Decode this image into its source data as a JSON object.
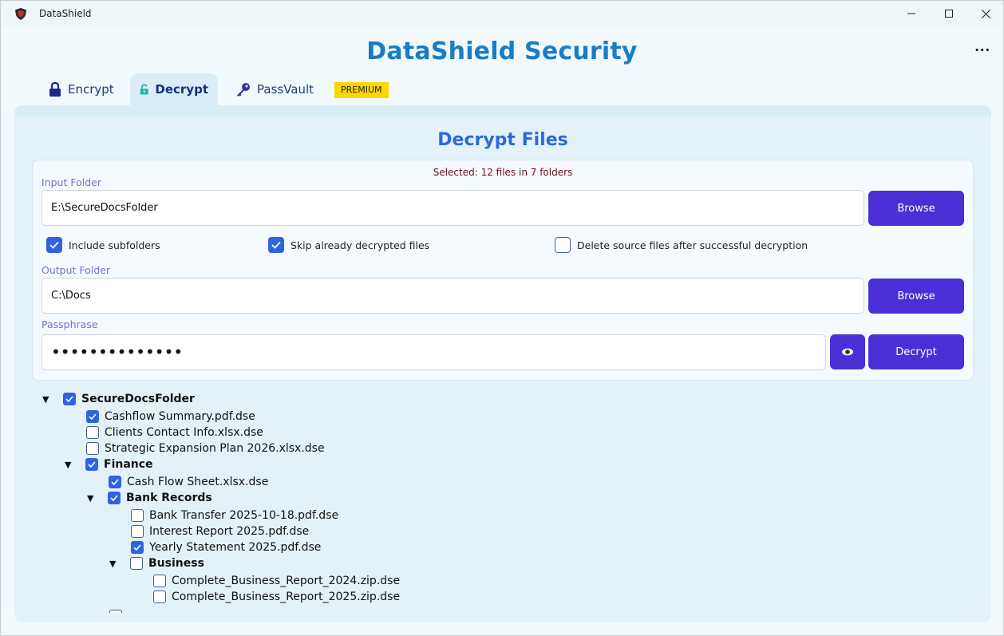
{
  "window": {
    "title": "DataShield",
    "controls": [
      "minimize-icon",
      "maximize-icon",
      "close-icon"
    ]
  },
  "app": {
    "title": "DataShield Security",
    "more_menu": "..."
  },
  "tabs": [
    {
      "label": "Encrypt",
      "icon": "lock-icon",
      "active": false
    },
    {
      "label": "Decrypt",
      "icon": "unlock-icon",
      "active": true
    },
    {
      "label": "PassVault",
      "icon": "key-icon",
      "active": false
    }
  ],
  "premium_badge": "PREMIUM",
  "panel": {
    "title": "Decrypt Files",
    "selected_info": "Selected: 12 files in 7 folders"
  },
  "form": {
    "input_folder": {
      "label": "Input Folder",
      "value": "E:\\SecureDocsFolder",
      "browse": "Browse"
    },
    "options": [
      {
        "label": "Include subfolders",
        "checked": true
      },
      {
        "label": "Skip already decrypted files",
        "checked": true
      },
      {
        "label": "Delete source files after successful decryption",
        "checked": false
      }
    ],
    "output_folder": {
      "label": "Output Folder",
      "value": "C:\\Docs",
      "browse": "Browse"
    },
    "passphrase": {
      "label": "Passphrase",
      "value": "••••••••••••••",
      "toggle_icon": "eye-icon",
      "action": "Decrypt"
    }
  },
  "tree": [
    {
      "label": "SecureDocsFolder",
      "folder": true,
      "checked": true,
      "level": 0
    },
    {
      "label": "Cashflow Summary.pdf.dse",
      "folder": false,
      "checked": true,
      "level": 1
    },
    {
      "label": "Clients Contact Info.xlsx.dse",
      "folder": false,
      "checked": false,
      "level": 1
    },
    {
      "label": "Strategic Expansion Plan 2026.xlsx.dse",
      "folder": false,
      "checked": false,
      "level": 1
    },
    {
      "label": "Finance",
      "folder": true,
      "checked": true,
      "level": 1
    },
    {
      "label": "Cash Flow Sheet.xlsx.dse",
      "folder": false,
      "checked": true,
      "level": 2
    },
    {
      "label": "Bank Records",
      "folder": true,
      "checked": true,
      "level": 2
    },
    {
      "label": "Bank Transfer 2025-10-18.pdf.dse",
      "folder": false,
      "checked": false,
      "level": 3
    },
    {
      "label": "Interest Report 2025.pdf.dse",
      "folder": false,
      "checked": false,
      "level": 3
    },
    {
      "label": "Yearly Statement 2025.pdf.dse",
      "folder": false,
      "checked": true,
      "level": 3
    },
    {
      "label": "Business",
      "folder": true,
      "checked": false,
      "level": 3
    },
    {
      "label": "Complete_Business_Report_2024.zip.dse",
      "folder": false,
      "checked": false,
      "level": 4
    },
    {
      "label": "Complete_Business_Report_2025.zip.dse",
      "folder": false,
      "checked": false,
      "level": 4
    }
  ],
  "colors": {
    "accent": "#4a2fd6",
    "title": "#1a7cc7",
    "checkbox": "#2f63e0",
    "premium": "#ffd600"
  }
}
